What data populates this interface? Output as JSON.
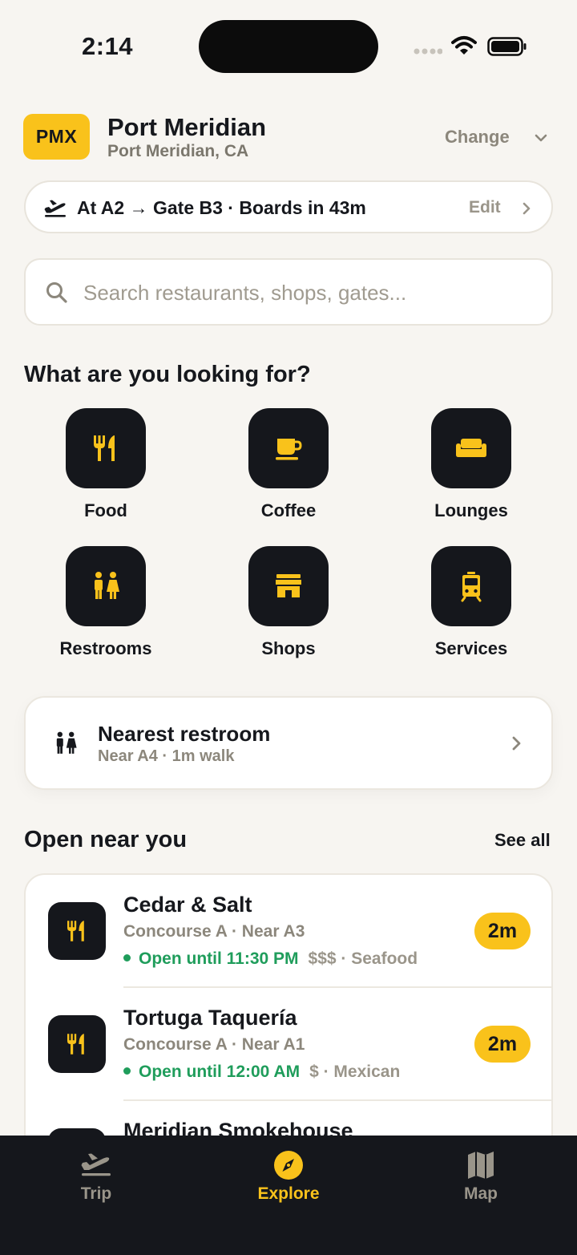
{
  "status_bar": {
    "time": "2:14"
  },
  "airport": {
    "code": "PMX",
    "name": "Port Meridian",
    "city": "Port Meridian, CA",
    "change_label": "Change"
  },
  "trip": {
    "summary": "At A2 → Gate B3 · Boards in 43m",
    "edit_label": "Edit"
  },
  "search": {
    "placeholder": "Search restaurants, shops, gates..."
  },
  "categories": {
    "title": "What are you looking for?",
    "items": [
      {
        "label": "Food",
        "icon": "fork-knife-icon"
      },
      {
        "label": "Coffee",
        "icon": "coffee-cup-icon"
      },
      {
        "label": "Lounges",
        "icon": "sofa-icon"
      },
      {
        "label": "Restrooms",
        "icon": "restroom-icon"
      },
      {
        "label": "Shops",
        "icon": "storefront-icon"
      },
      {
        "label": "Services",
        "icon": "tram-icon"
      }
    ]
  },
  "nearest_restroom": {
    "title": "Nearest restroom",
    "subtitle": "Near A4 · 1m walk"
  },
  "open_near_you": {
    "title": "Open near you",
    "see_all_label": "See all",
    "places": [
      {
        "name": "Cedar & Salt",
        "location": "Concourse A · Near A3",
        "open_text": "Open until 11:30 PM",
        "meta": "$$$ · Seafood",
        "walk": "2m"
      },
      {
        "name": "Tortuga Taquería",
        "location": "Concourse A · Near A1",
        "open_text": "Open until 12:00 AM",
        "meta": "$ · Mexican",
        "walk": "2m"
      },
      {
        "name": "Meridian Smokehouse"
      }
    ]
  },
  "tabbar": {
    "tabs": [
      {
        "label": "Trip",
        "icon": "airplane-takeoff-icon",
        "active": false
      },
      {
        "label": "Explore",
        "icon": "compass-icon",
        "active": true
      },
      {
        "label": "Map",
        "icon": "map-icon",
        "active": false
      }
    ]
  },
  "colors": {
    "accent": "#f9c21b",
    "dark": "#15171c",
    "background": "#f7f5f1",
    "open_green": "#1f9d5b",
    "muted": "#8c877c",
    "tab_inactive": "#9a958a"
  }
}
